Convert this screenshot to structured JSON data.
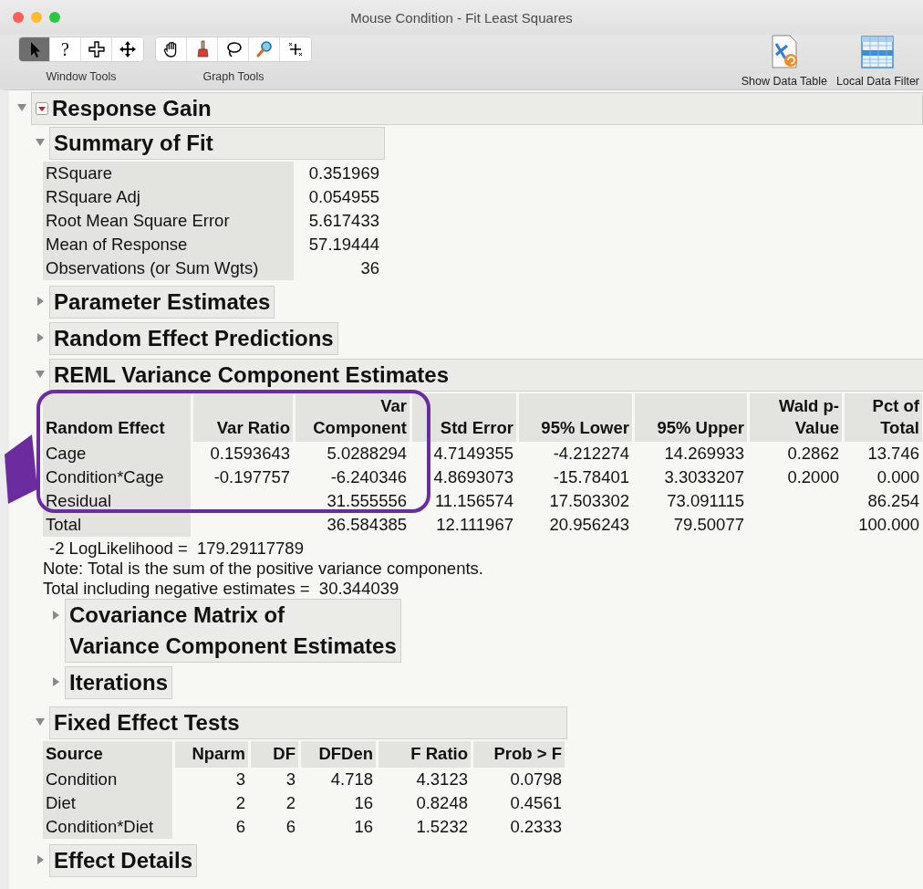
{
  "window": {
    "title": "Mouse Condition - Fit Least Squares"
  },
  "toolbar": {
    "groups": [
      {
        "label": "Window Tools",
        "tools": [
          {
            "kind": "arrow",
            "selected": true
          },
          {
            "kind": "help",
            "glyph": "?",
            "selected": false
          },
          {
            "kind": "crosshair",
            "selected": false
          },
          {
            "kind": "move",
            "selected": false
          }
        ]
      },
      {
        "label": "Graph Tools",
        "tools": [
          {
            "kind": "hand",
            "selected": false
          },
          {
            "kind": "brush",
            "selected": false
          },
          {
            "kind": "lasso",
            "selected": false
          },
          {
            "kind": "magnifier",
            "selected": false
          },
          {
            "kind": "scaler",
            "selected": false
          }
        ]
      }
    ],
    "actions": [
      {
        "kind": "data-table",
        "label": "Show Data Table"
      },
      {
        "kind": "filter",
        "label": "Local Data Filter"
      }
    ]
  },
  "report": {
    "title": "Response Gain",
    "expanded": true,
    "menu": true,
    "children": [
      {
        "title": "Summary of Fit",
        "expanded": true,
        "blocks": [
          {
            "kind": "summary-table",
            "rows": [
              [
                "RSquare",
                "0.351969"
              ],
              [
                "RSquare Adj",
                "0.054955"
              ],
              [
                "Root Mean Square Error",
                "5.617433"
              ],
              [
                "Mean of Response",
                "57.19444"
              ],
              [
                "Observations (or Sum Wgts)",
                "36"
              ]
            ]
          }
        ]
      },
      {
        "title": "Parameter Estimates",
        "expanded": false
      },
      {
        "title": "Random Effect Predictions",
        "expanded": false
      },
      {
        "title": "REML Variance Component Estimates",
        "expanded": true,
        "blocks": [
          {
            "kind": "reml-table",
            "highlighted": true,
            "columns": [
              "Random Effect",
              "Var Ratio",
              "Var\nComponent",
              "Std Error",
              "95% Lower",
              "95% Upper",
              "Wald p-\nValue",
              "Pct of\nTotal"
            ],
            "rows": [
              [
                "Cage",
                "0.1593643",
                "5.0288294",
                "4.7149355",
                "-4.212274",
                "14.269933",
                "0.2862",
                "13.746"
              ],
              [
                "Condition*Cage",
                "-0.197757",
                "-6.240346",
                "4.8693073",
                "-15.78401",
                "3.3033207",
                "0.2000",
                "0.000"
              ],
              [
                "Residual",
                null,
                "31.555556",
                "11.156574",
                "17.503302",
                "73.091115",
                null,
                "86.254"
              ],
              [
                "Total",
                null,
                "36.584385",
                "12.111967",
                "20.956243",
                "79.50077",
                null,
                "100.000"
              ]
            ]
          },
          {
            "kind": "note",
            "indent": true,
            "text": "-2 LogLikelihood =  179.29117789"
          },
          {
            "kind": "note",
            "indent": false,
            "text": "Note: Total is the sum of the positive variance components."
          },
          {
            "kind": "note",
            "indent": false,
            "text": "Total including negative estimates =  30.344039"
          }
        ],
        "children": [
          {
            "title": "Covariance Matrix of\nVariance Component Estimates",
            "expanded": false
          },
          {
            "title": "Iterations",
            "expanded": false
          }
        ]
      },
      {
        "title": "Fixed Effect Tests",
        "expanded": true,
        "blocks": [
          {
            "kind": "tests-table",
            "columns": [
              "Source",
              "Nparm",
              "DF",
              "DFDen",
              "F Ratio",
              "Prob > F"
            ],
            "rows": [
              [
                "Condition",
                "3",
                "3",
                "4.718",
                "4.3123",
                "0.0798"
              ],
              [
                "Diet",
                "2",
                "2",
                "16",
                "0.8248",
                "0.4561"
              ],
              [
                "Condition*Diet",
                "6",
                "6",
                "16",
                "1.5232",
                "0.2333"
              ]
            ]
          }
        ]
      },
      {
        "title": "Effect Details",
        "expanded": false
      }
    ]
  }
}
